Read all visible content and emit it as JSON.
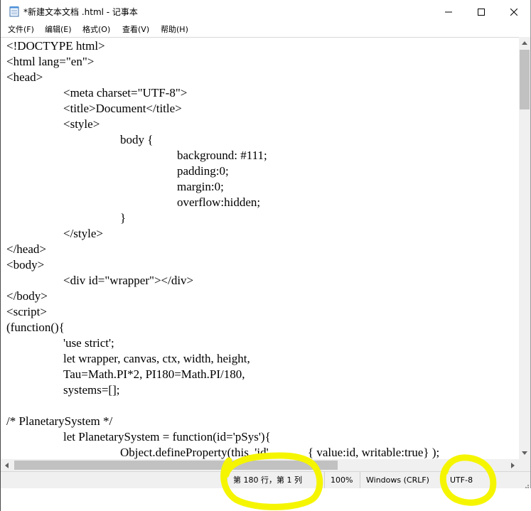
{
  "window": {
    "title": "*新建文本文档 .html - 记事本"
  },
  "menu": {
    "items": [
      {
        "label": "文件(F)"
      },
      {
        "label": "编辑(E)"
      },
      {
        "label": "格式(O)"
      },
      {
        "label": "查看(V)"
      },
      {
        "label": "帮助(H)"
      }
    ]
  },
  "editor": {
    "lines": [
      "<!DOCTYPE html>",
      "<html lang=\"en\">",
      "<head>",
      "\t<meta charset=\"UTF-8\">",
      "\t<title>Document</title>",
      "\t<style>",
      "\t\tbody {",
      "\t\t\tbackground: #111;",
      "\t\t\tpadding:0;",
      "\t\t\tmargin:0;",
      "\t\t\toverflow:hidden;",
      "\t\t}",
      "\t</style>",
      "</head>",
      "<body>",
      "\t<div id=\"wrapper\"></div>",
      "</body>",
      "<script>",
      "(function(){",
      "\t'use strict';",
      "\tlet wrapper, canvas, ctx, width, height,",
      "\tTau=Math.PI*2, PI180=Math.PI/180,",
      "\tsystems=[];",
      "",
      "/* PlanetarySystem */",
      "\tlet PlanetarySystem = function(id='pSys'){",
      "\t\tObject.defineProperty(this, 'id',\t\t{ value:id, writable:true} );"
    ]
  },
  "status": {
    "position": "第 180 行，第 1 列",
    "zoom": "100%",
    "line_ending": "Windows (CRLF)",
    "encoding": "UTF-8"
  },
  "icons": {
    "app": "notepad-icon",
    "minimize": "minimize-icon",
    "maximize": "maximize-icon",
    "close": "close-icon"
  },
  "colors": {
    "highlighter": "#f5f500",
    "scroll_thumb": "#c1c1c1",
    "statusbar_bg": "#f0f0f0"
  }
}
